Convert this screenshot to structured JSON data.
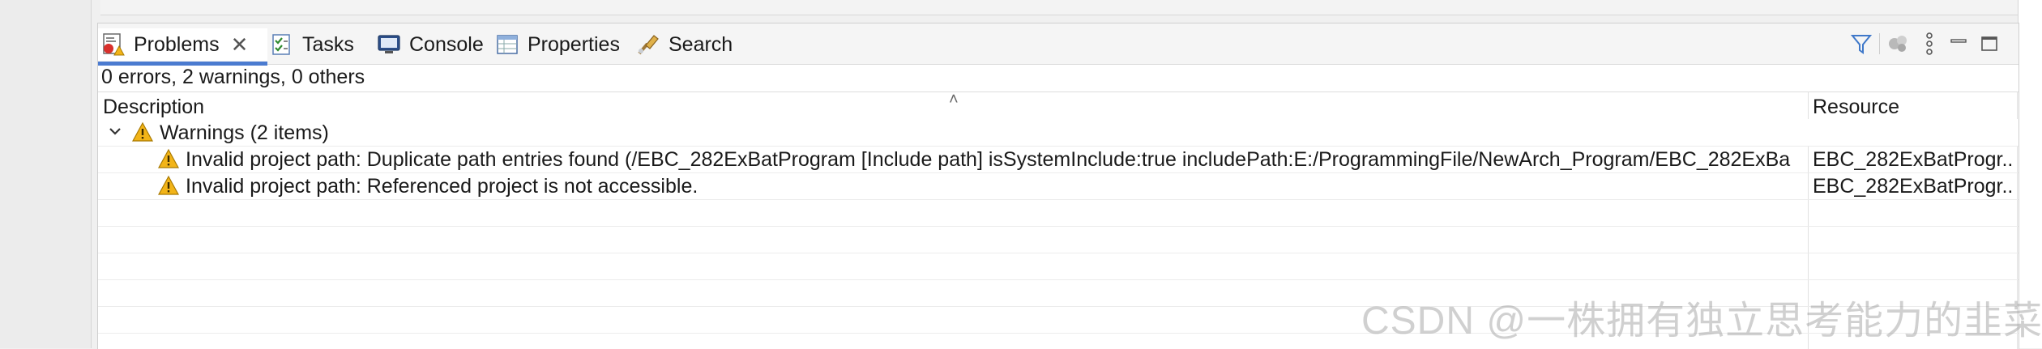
{
  "tabs": [
    {
      "label": "Problems",
      "icon": "problems-icon",
      "active": true
    },
    {
      "label": "Tasks",
      "icon": "tasks-icon"
    },
    {
      "label": "Console",
      "icon": "console-icon"
    },
    {
      "label": "Properties",
      "icon": "properties-icon"
    },
    {
      "label": "Search",
      "icon": "search-icon"
    }
  ],
  "toolbar": {
    "icons": [
      "filter-icon",
      "configure-icon",
      "view-menu-icon",
      "minimize-icon",
      "maximize-icon"
    ]
  },
  "summary": "0 errors, 2 warnings, 0 others",
  "table": {
    "columns": [
      "Description",
      "Resource"
    ],
    "group": {
      "label": "Warnings (2 items)",
      "expanded": true
    },
    "rows": [
      {
        "description": "Invalid project path: Duplicate path entries found (/EBC_282ExBatProgram [Include path] isSystemInclude:true includePath:E:/ProgrammingFile/NewArch_Program/EBC_282ExBa",
        "resource": "EBC_282ExBatProgr..."
      },
      {
        "description": "Invalid project path: Referenced project is not accessible.",
        "resource": "EBC_282ExBatProgr..."
      }
    ]
  },
  "watermark": "CSDN @一株拥有独立思考能力的韭菜",
  "colors": {
    "accent": "#4b7bd0",
    "warning": "#f2b418"
  }
}
